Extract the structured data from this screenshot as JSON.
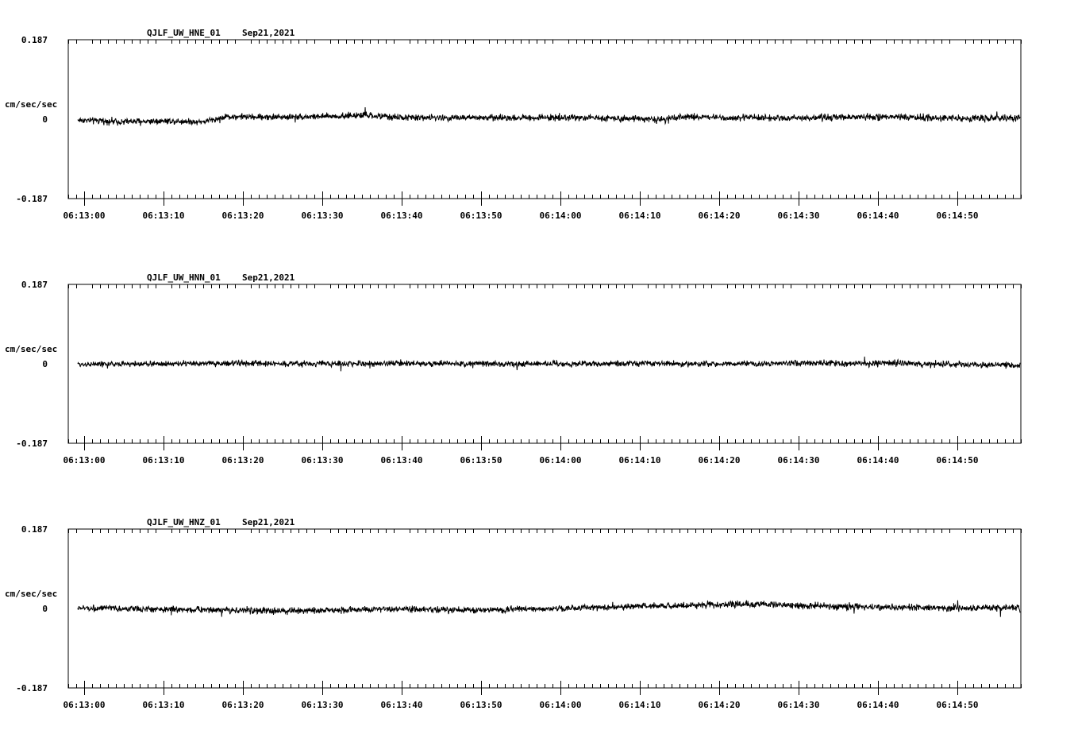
{
  "chart_data": [
    {
      "type": "line",
      "title": "QJLF_UW_HNE_01",
      "date": "Sep21,2021",
      "ylabel": "cm/sec/sec",
      "ylim": [
        -0.187,
        0.187
      ],
      "yticks": [
        {
          "value": 0.187,
          "label": "0.187"
        },
        {
          "value": 0,
          "label": "0"
        },
        {
          "value": -0.187,
          "label": "-0.187"
        }
      ],
      "xticks": [
        "06:13:00",
        "06:13:10",
        "06:13:20",
        "06:13:30",
        "06:13:40",
        "06:13:50",
        "06:14:00",
        "06:14:10",
        "06:14:20",
        "06:14:30",
        "06:14:40",
        "06:14:50"
      ],
      "xrange_seconds": [
        -2,
        118
      ],
      "series": [
        {
          "x_seconds": [
            -0.8,
            5,
            10,
            15,
            18,
            22,
            30,
            35,
            40,
            50,
            60,
            70,
            73,
            76,
            80,
            90,
            100,
            110,
            117.9
          ],
          "center": [
            -0.002,
            -0.006,
            -0.004,
            -0.006,
            0.006,
            0.005,
            0.006,
            0.009,
            0.004,
            0.003,
            0.004,
            0.002,
            -0.002,
            0.006,
            0.004,
            0.003,
            0.005,
            0.002,
            0.003
          ],
          "noise_amplitude": [
            0.01,
            0.012,
            0.011,
            0.01,
            0.011,
            0.011,
            0.011,
            0.012,
            0.011,
            0.011,
            0.011,
            0.011,
            0.012,
            0.011,
            0.011,
            0.011,
            0.012,
            0.012,
            0.012
          ]
        }
      ]
    },
    {
      "type": "line",
      "title": "QJLF_UW_HNN_01",
      "date": "Sep21,2021",
      "ylabel": "cm/sec/sec",
      "ylim": [
        -0.187,
        0.187
      ],
      "yticks": [
        {
          "value": 0.187,
          "label": "0.187"
        },
        {
          "value": 0,
          "label": "0"
        },
        {
          "value": -0.187,
          "label": "-0.187"
        }
      ],
      "xticks": [
        "06:13:00",
        "06:13:10",
        "06:13:20",
        "06:13:30",
        "06:13:40",
        "06:13:50",
        "06:14:00",
        "06:14:10",
        "06:14:20",
        "06:14:30",
        "06:14:40",
        "06:14:50"
      ],
      "xrange_seconds": [
        -2,
        118
      ],
      "series": [
        {
          "x_seconds": [
            -0.8,
            10,
            20,
            30,
            40,
            50,
            60,
            70,
            80,
            90,
            100,
            110,
            117.9
          ],
          "center": [
            -0.001,
            0.0,
            0.001,
            0.0,
            0.001,
            0.0,
            0.0,
            0.001,
            0.0,
            0.001,
            0.001,
            -0.001,
            -0.004
          ],
          "noise_amplitude": [
            0.009,
            0.01,
            0.01,
            0.01,
            0.01,
            0.01,
            0.01,
            0.01,
            0.01,
            0.01,
            0.011,
            0.011,
            0.01
          ]
        }
      ]
    },
    {
      "type": "line",
      "title": "QJLF_UW_HNZ_01",
      "date": "Sep21,2021",
      "ylabel": "cm/sec/sec",
      "ylim": [
        -0.187,
        0.187
      ],
      "yticks": [
        {
          "value": 0.187,
          "label": "0.187"
        },
        {
          "value": 0,
          "label": "0"
        },
        {
          "value": -0.187,
          "label": "-0.187"
        }
      ],
      "xticks": [
        "06:13:00",
        "06:13:10",
        "06:13:20",
        "06:13:30",
        "06:13:40",
        "06:13:50",
        "06:14:00",
        "06:14:10",
        "06:14:20",
        "06:14:30",
        "06:14:40",
        "06:14:50"
      ],
      "xrange_seconds": [
        -2,
        118
      ],
      "series": [
        {
          "x_seconds": [
            -0.8,
            10,
            20,
            24,
            30,
            40,
            50,
            60,
            70,
            80,
            85,
            90,
            95,
            100,
            110,
            117.9
          ],
          "center": [
            0.001,
            -0.002,
            -0.004,
            -0.006,
            -0.004,
            -0.002,
            -0.004,
            0.0,
            0.005,
            0.009,
            0.01,
            0.007,
            0.005,
            0.003,
            0.001,
            0.001
          ],
          "noise_amplitude": [
            0.01,
            0.011,
            0.011,
            0.012,
            0.011,
            0.011,
            0.011,
            0.011,
            0.011,
            0.012,
            0.013,
            0.012,
            0.012,
            0.011,
            0.012,
            0.012
          ]
        }
      ]
    }
  ]
}
